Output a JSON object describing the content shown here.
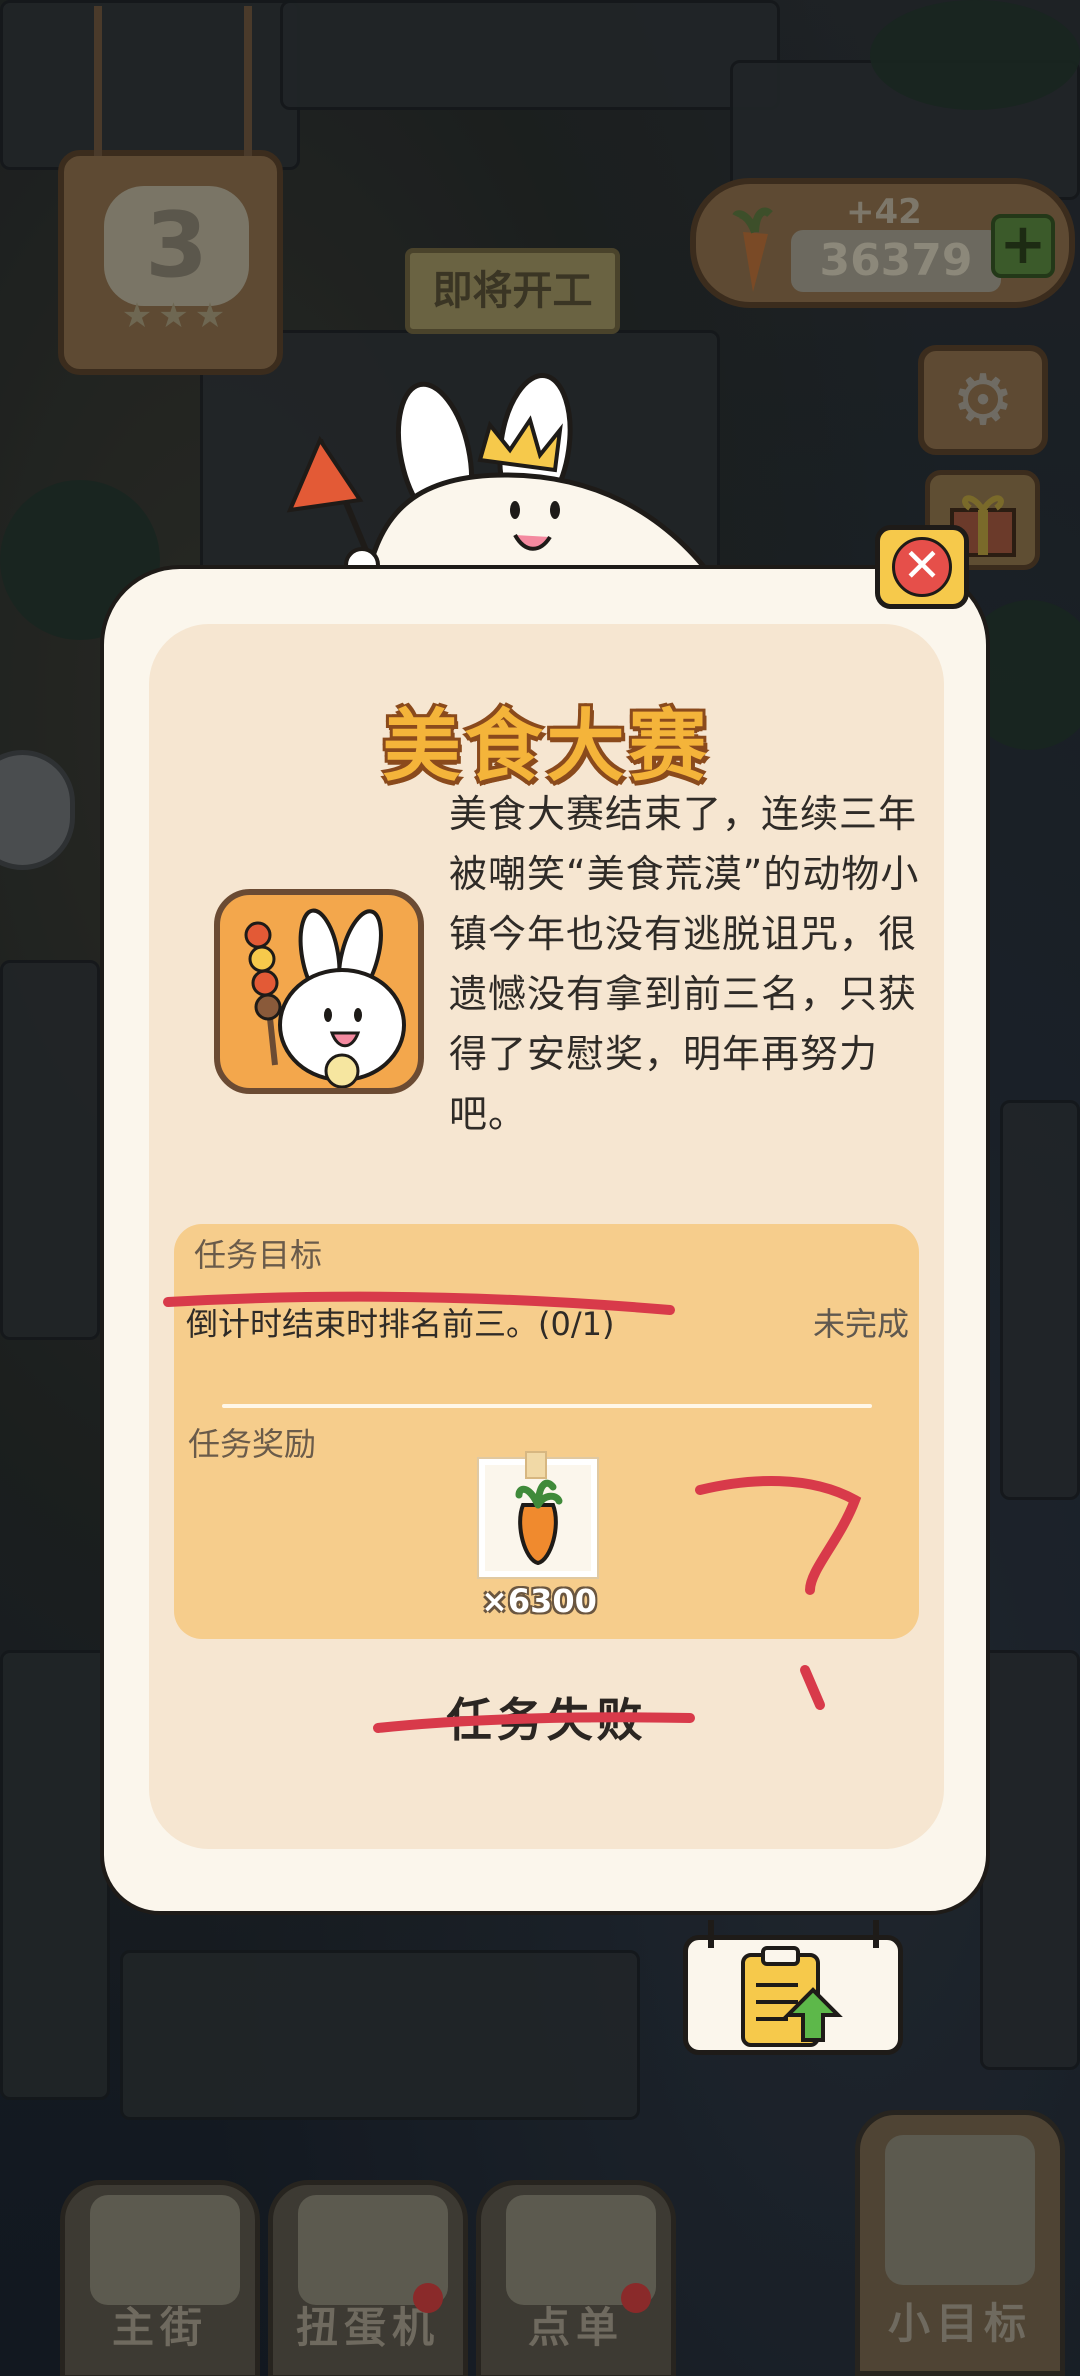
{
  "hud": {
    "level": "3",
    "level_stars": "★★★",
    "upcoming_label": "即将开工",
    "carrot_bonus": "+42",
    "carrot_total": "36379",
    "add_carrots": "+",
    "settings_icon": "gear-icon",
    "gift_icon": "gift-icon"
  },
  "dialog": {
    "title": "美食大赛",
    "story": "美食大赛结束了，连续三年被嘲笑“美食荒漠”的动物小镇今年也没有逃脱诅咒，很遗憾没有拿到前三名，只获得了安慰奖，明年再努力吧。",
    "close_icon": "close-icon",
    "task": {
      "goal_label": "任务目标",
      "goal_text": "倒计时结束时排名前三。(0/1)",
      "status": "未完成",
      "reward_label": "任务奖励",
      "reward_icon": "carrot-icon",
      "reward_count": "×6300"
    },
    "result": "任务失败"
  },
  "bottom_nav": [
    {
      "label": "主街",
      "icon": "map-icon"
    },
    {
      "label": "扭蛋机",
      "icon": "gacha-icon"
    },
    {
      "label": "点单",
      "icon": "order-icon"
    },
    {
      "label": "小目标",
      "icon": "goal-icon"
    }
  ],
  "colors": {
    "dialog_bg": "#fbf6ec",
    "panel_bg": "#f6e6d1",
    "task_bg": "#f6cd8c",
    "title_color": "#f4b43a",
    "close_red": "#e64f4a",
    "scribble_red": "#d83a4a"
  }
}
